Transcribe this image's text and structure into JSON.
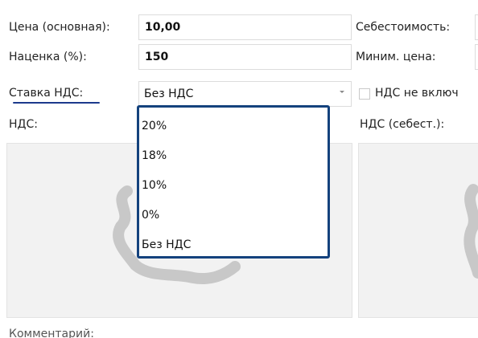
{
  "form": {
    "price_label": "Цена (основная):",
    "price_value": "10,00",
    "markup_label": "Наценка (%):",
    "markup_value": "150",
    "vat_rate_label": "Ставка НДС:",
    "vat_rate_selected": "Без НДС",
    "vat_label": "НДС:",
    "cost_label": "Себестоимость:",
    "min_price_label": "Миним. цена:",
    "vat_not_included_label": "НДС не включ",
    "vat_cost_label": "НДС (себест.):",
    "comment_label": "Комментарий:"
  },
  "dropdown": {
    "options": [
      "20%",
      "18%",
      "10%",
      "0%",
      "Без НДС"
    ]
  },
  "colors": {
    "highlight_border": "#14427d",
    "underline": "#1c3a8c"
  },
  "icons": {
    "combo_arrow": "chevron-down-icon",
    "placeholder": "scribble-placeholder-icon"
  }
}
